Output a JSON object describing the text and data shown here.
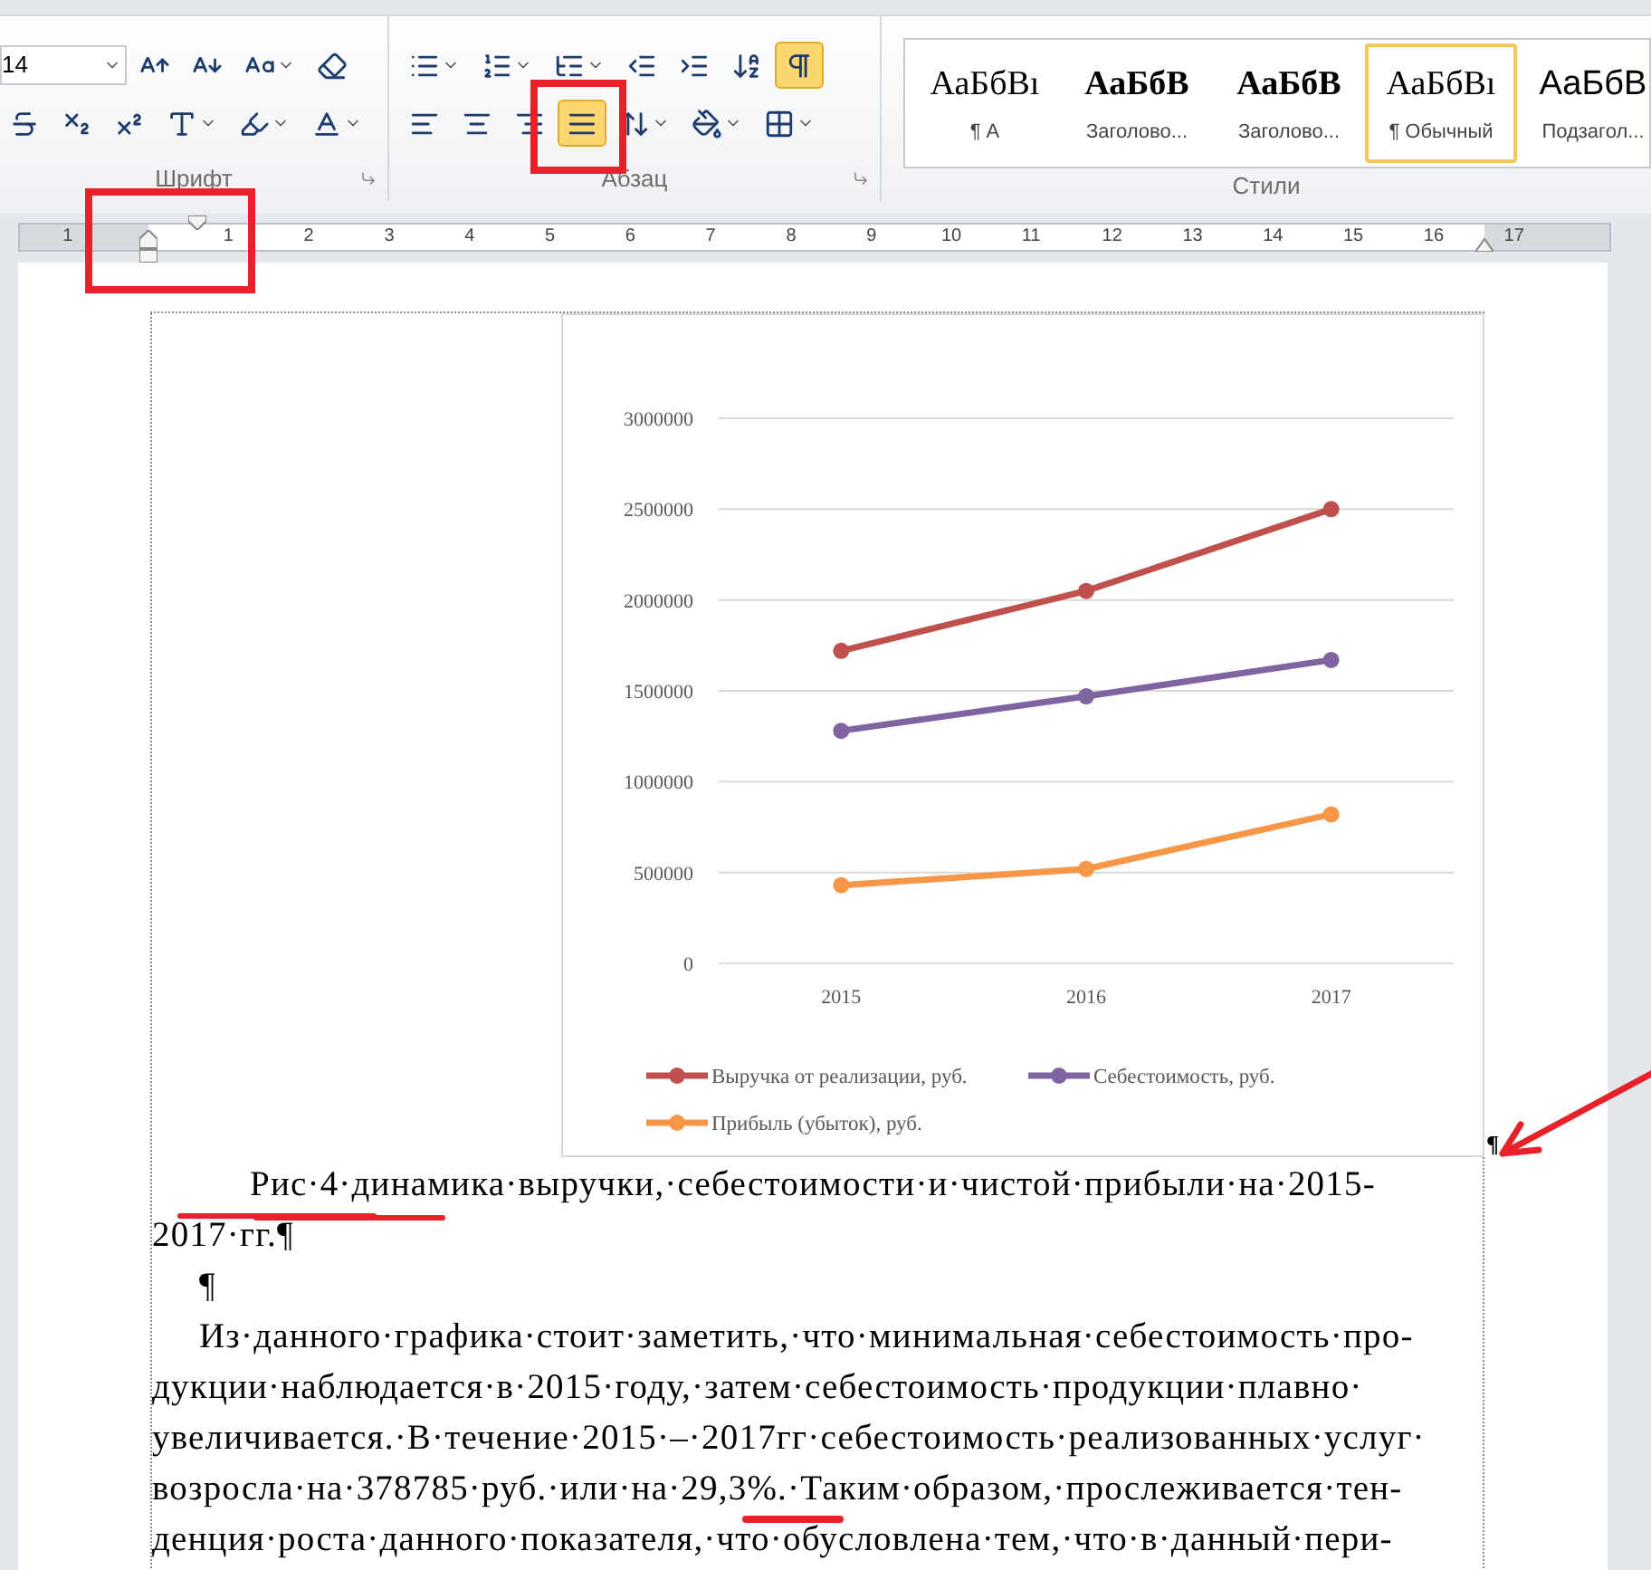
{
  "ribbon": {
    "font": {
      "label": "Шрифт",
      "font_size": "14",
      "buttons": [
        {
          "kind": "grow",
          "selected": false
        },
        {
          "kind": "shrink",
          "selected": false
        },
        {
          "kind": "case",
          "selected": false
        },
        {
          "kind": "clear",
          "selected": false
        },
        {
          "kind": "strike",
          "selected": false
        },
        {
          "kind": "sub",
          "selected": false
        },
        {
          "kind": "sup",
          "selected": false
        },
        {
          "kind": "effects",
          "selected": false
        },
        {
          "kind": "highlight",
          "selected": false
        },
        {
          "kind": "color",
          "selected": false
        }
      ]
    },
    "paragraph": {
      "label": "Абзац",
      "buttons": [
        {
          "kind": "bullets",
          "selected": false
        },
        {
          "kind": "numbering",
          "selected": false
        },
        {
          "kind": "multilevel",
          "selected": false
        },
        {
          "kind": "outdent",
          "selected": false
        },
        {
          "kind": "indent",
          "selected": false
        },
        {
          "kind": "sort",
          "selected": false
        },
        {
          "kind": "marks",
          "selected": true
        },
        {
          "kind": "left",
          "selected": false
        },
        {
          "kind": "center",
          "selected": false
        },
        {
          "kind": "right",
          "selected": false
        },
        {
          "kind": "justify",
          "selected": true
        },
        {
          "kind": "spacing",
          "selected": false
        },
        {
          "kind": "shading",
          "selected": false
        },
        {
          "kind": "borders",
          "selected": false
        }
      ]
    },
    "styles": {
      "label": "Стили",
      "items": [
        {
          "preview": "АаБбВı",
          "name": "¶ А",
          "bold": false,
          "selected": false
        },
        {
          "preview": "АаБбВ",
          "name": "Заголово...",
          "bold": true,
          "selected": false
        },
        {
          "preview": "АаБбВ",
          "name": "Заголово...",
          "bold": true,
          "selected": false
        },
        {
          "preview": "АаБбВı",
          "name": "¶ Обычный",
          "bold": false,
          "selected": true
        },
        {
          "preview": "АаБбВ",
          "name": "Подзагол...",
          "bold": false,
          "selected": false
        }
      ]
    }
  },
  "ruler": {
    "left_label": "1",
    "labels": [
      "1",
      "2",
      "3",
      "4",
      "5",
      "6",
      "7",
      "8",
      "9",
      "10",
      "11",
      "12",
      "13",
      "14",
      "15",
      "16",
      "17"
    ]
  },
  "document": {
    "chart_data": {
      "type": "line",
      "grid": true,
      "legend": true,
      "categories": [
        "2015",
        "2016",
        "2017"
      ],
      "ylim": [
        0,
        3000000
      ],
      "yticks": [
        0,
        500000,
        1000000,
        1500000,
        2000000,
        2500000,
        3000000
      ],
      "series": [
        {
          "name": "Выручка от реализации, руб.",
          "color": "#c0504d",
          "marker": "circle",
          "values": [
            1720000,
            2050000,
            2500000
          ]
        },
        {
          "name": "Себестоимость, руб.",
          "color": "#8064a2",
          "marker": "circle",
          "values": [
            1280000,
            1470000,
            1670000
          ]
        },
        {
          "name": "Прибыль (убыток), руб.",
          "color": "#f79646",
          "marker": "circle",
          "values": [
            430000,
            520000,
            820000
          ]
        }
      ]
    },
    "chart_mark": "¶",
    "caption_lines": [
      "Рис·4·динамика·выручки,·себестоимости·и·чистой·прибыли·на·2015-",
      "2017·гг.¶"
    ],
    "empty_paragraph": "¶",
    "body_lines": [
      "Из·данного·графика·стоит·заметить,·что·минимальная·себестоимость·про-",
      "дукции·наблюдается·в·2015·году,·затем·себестоимость·продукции·плавно·",
      "увеличивается.·В·течение·2015·–·2017гг·себестоимость·реализованных·услуг·",
      "возросла·на·378785·руб.·или·на·29,3%.·Таким·образом,·прослеживается·тен-",
      "денция·роста·данного·показателя,·что·обусловлена·тем,·что·в·данный·пери-"
    ]
  }
}
